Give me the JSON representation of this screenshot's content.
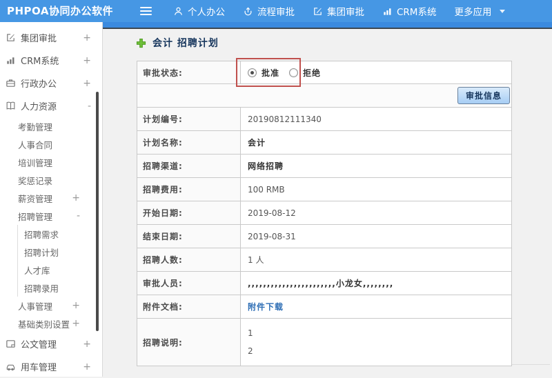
{
  "colors": {
    "topbar_blue": "#4697e4",
    "strip_blue": "#3a8adf",
    "annotation_red": "#c0504d",
    "link_blue": "#2e6eb5",
    "button_face": "#a6cdf4"
  },
  "topbar": {
    "logo": "PHPOA协同办公软件",
    "hamburger_icon": "hamburger-icon",
    "menu": [
      {
        "label": "个人办公",
        "icon": "person-icon"
      },
      {
        "label": "流程审批",
        "icon": "process-arrow-icon"
      },
      {
        "label": "集团审批",
        "icon": "edit-square-icon"
      },
      {
        "label": "CRM系统",
        "icon": "bar-chart-icon"
      },
      {
        "label": "更多应用",
        "icon": "chevron-down-icon"
      }
    ]
  },
  "sidebar": {
    "items": [
      {
        "label": "集团审批",
        "toggle": "+",
        "icon": "edit-square-icon"
      },
      {
        "label": "CRM系统",
        "toggle": "+",
        "icon": "bar-chart-icon"
      },
      {
        "label": "行政办公",
        "toggle": "+",
        "icon": "briefcase-icon"
      },
      {
        "label": "人力资源",
        "toggle": "-",
        "icon": "open-book-icon"
      },
      {
        "label": "公文管理",
        "toggle": "+",
        "icon": "document-icon"
      },
      {
        "label": "用车管理",
        "toggle": "+",
        "icon": "car-icon"
      }
    ],
    "hr_children": [
      {
        "label": "考勤管理",
        "toggle": ""
      },
      {
        "label": "人事合同",
        "toggle": ""
      },
      {
        "label": "培训管理",
        "toggle": ""
      },
      {
        "label": "奖惩记录",
        "toggle": ""
      },
      {
        "label": "薪资管理",
        "toggle": "+"
      },
      {
        "label": "招聘管理",
        "toggle": "-"
      },
      {
        "label": "人事管理",
        "toggle": "+"
      },
      {
        "label": "基础类别设置",
        "toggle": "+"
      }
    ],
    "recruit_children": [
      {
        "label": "招聘需求"
      },
      {
        "label": "招聘计划"
      },
      {
        "label": "人才库"
      },
      {
        "label": "招聘录用"
      }
    ]
  },
  "page": {
    "title": "会计 招聘计划",
    "title_icon": "green-plus-icon"
  },
  "form": {
    "status_label": "审批状态:",
    "status_options": [
      {
        "label": "批准",
        "selected": true
      },
      {
        "label": "拒绝",
        "selected": false
      }
    ],
    "approve_button": "审批信息",
    "rows": [
      {
        "label": "计划编号:",
        "value": "20190812111340"
      },
      {
        "label": "计划名称:",
        "value": "会计"
      },
      {
        "label": "招聘渠道:",
        "value": "网络招聘"
      },
      {
        "label": "招聘费用:",
        "value": "100 RMB"
      },
      {
        "label": "开始日期:",
        "value": "2019-08-12"
      },
      {
        "label": "结束日期:",
        "value": "2019-08-31"
      },
      {
        "label": "招聘人数:",
        "value": "1 人"
      },
      {
        "label": "审批人员:",
        "value": ",,,,,,,,,,,,,,,,,,,,,,,小龙女,,,,,,,,"
      },
      {
        "label": "附件文档:",
        "value": "附件下载"
      },
      {
        "label": "招聘说明:",
        "value_lines": [
          "1",
          "2"
        ]
      }
    ]
  }
}
